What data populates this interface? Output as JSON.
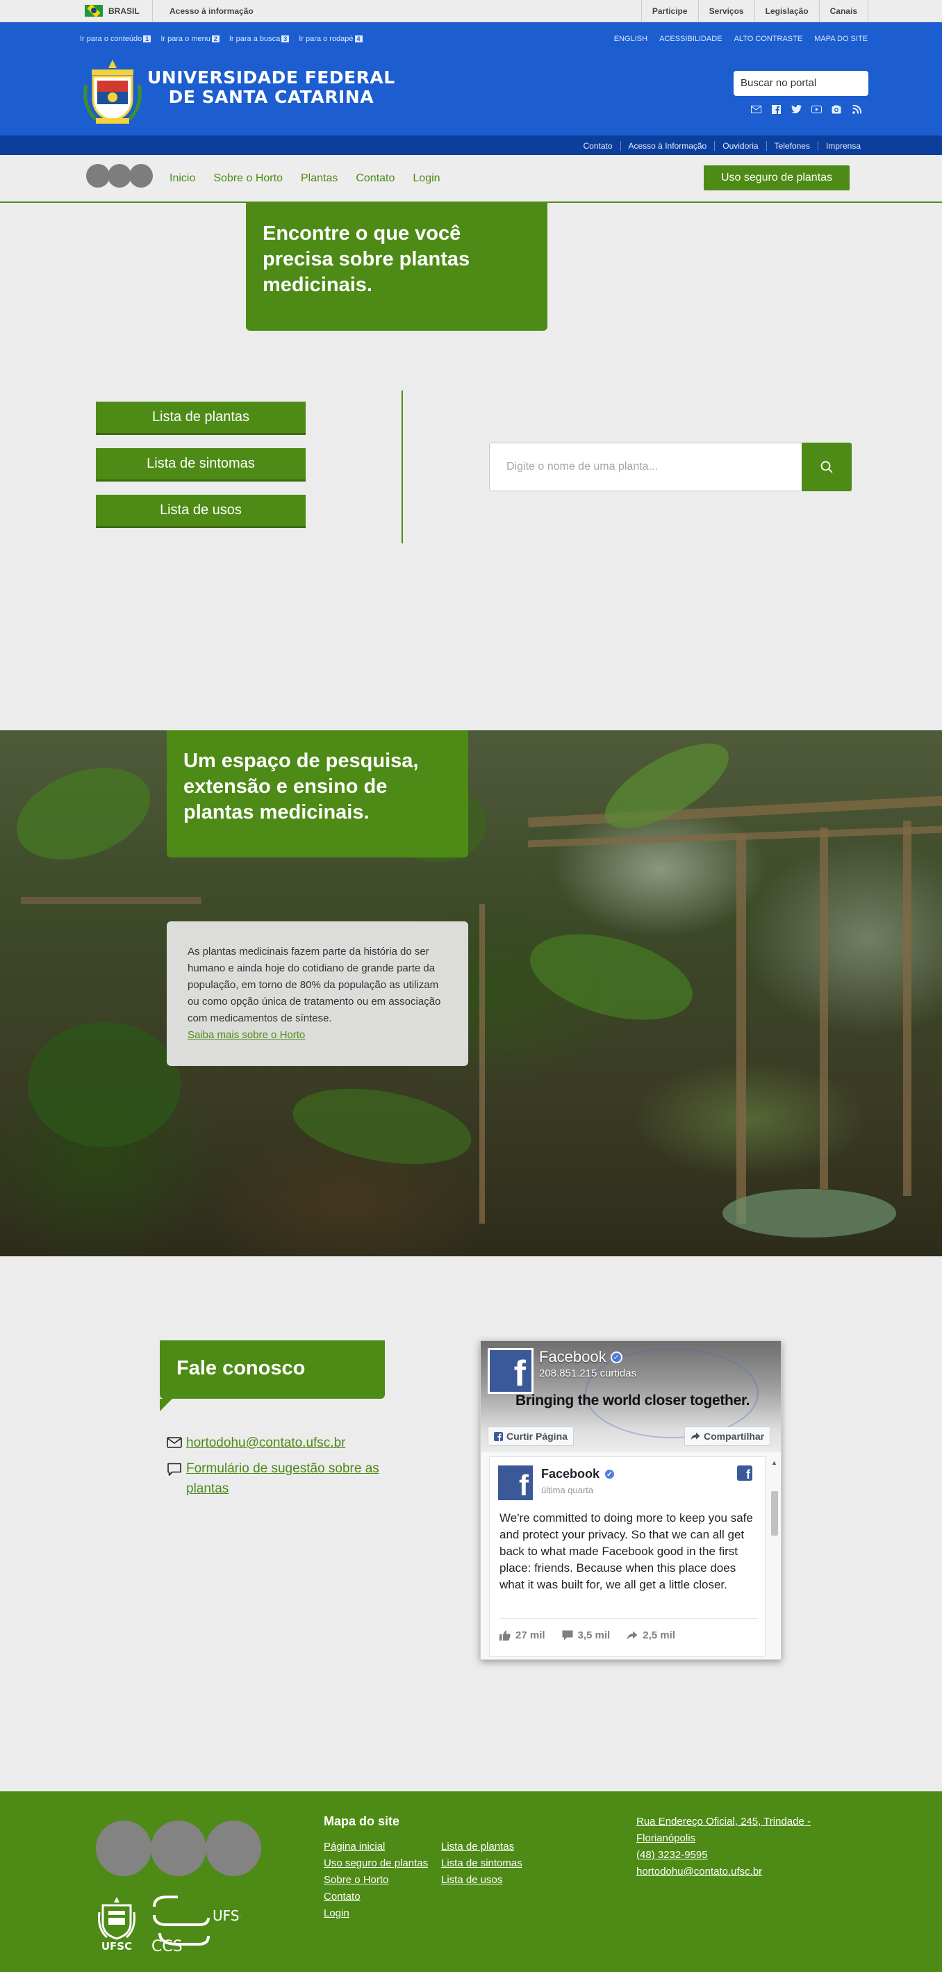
{
  "govbar": {
    "country": "BRASIL",
    "access_info": "Acesso à informação",
    "links": [
      "Participe",
      "Serviços",
      "Legislação",
      "Canais"
    ]
  },
  "header": {
    "skip_links": [
      {
        "label": "Ir para o conteúdo",
        "key": "1"
      },
      {
        "label": "Ir para o menu",
        "key": "2"
      },
      {
        "label": "Ir para a busca",
        "key": "3"
      },
      {
        "label": "Ir para o rodapé",
        "key": "4"
      }
    ],
    "top_links": [
      "ENGLISH",
      "ACESSIBILIDADE",
      "ALTO CONTRASTE",
      "MAPA DO SITE"
    ],
    "university_line1": "UNIVERSIDADE FEDERAL",
    "university_line2": "DE SANTA CATARINA",
    "search_placeholder": "Buscar no portal",
    "social_icons": [
      "email-icon",
      "facebook-icon",
      "twitter-icon",
      "youtube-icon",
      "instagram-icon",
      "rss-icon"
    ],
    "sub_links": [
      "Contato",
      "Acesso à Informação",
      "Ouvidoria",
      "Telefones",
      "Imprensa"
    ]
  },
  "nav": {
    "items": [
      "Inicio",
      "Sobre o Horto",
      "Plantas",
      "Contato",
      "Login"
    ],
    "cta": "Uso seguro de plantas"
  },
  "hero": {
    "title": "Encontre o que você precisa sobre plantas medicinais.",
    "buttons": [
      "Lista de plantas",
      "Lista de sintomas",
      "Lista de usos"
    ],
    "search_placeholder": "Digite o nome de uma planta..."
  },
  "garden": {
    "title": "Um espaço de pesquisa, extensão e ensino de plantas medicinais.",
    "text": "As plantas medicinais fazem parte da história do ser humano e ainda hoje do cotidiano de grande parte da população, em torno de 80% da população as utilizam ou como opção única de tratamento ou em associação com medicamentos de síntese.",
    "link": "Saiba mais sobre o Horto"
  },
  "contact": {
    "title": "Fale conosco",
    "email": "hortodohu@contato.ufsc.br",
    "form": "Formulário de sugestão sobre as plantas"
  },
  "facebook": {
    "page_name": "Facebook",
    "likes": "208.851.215 curtidas",
    "slogan": "Bringing the world closer together.",
    "like_button": "Curtir Página",
    "share_button": "Compartilhar",
    "post_author": "Facebook",
    "post_time": "última quarta",
    "post_body": "We're committed to doing more to keep you safe and protect your privacy. So that we can all get back to what made Facebook good in the first place: friends. Because when this place does what it was built for, we all get a little closer.",
    "reactions": "27 mil",
    "comments": "3,5 mil",
    "shares": "2,5 mil"
  },
  "footer": {
    "sitemap_title": "Mapa do site",
    "col1": [
      "Página inicial",
      "Uso seguro de plantas",
      "Sobre o Horto",
      "Contato",
      "Login"
    ],
    "col2": [
      "Lista de plantas",
      "Lista de sintomas",
      "Lista de usos"
    ],
    "address": "Rua Endereço Oficial, 245, Trindade - Florianópolis",
    "phone": "(48) 3232-9595",
    "email": "hortodohu@contato.ufsc.br",
    "logo_ufsc_text": "UFSC",
    "logo_ccs_text_1": "UFSC",
    "logo_ccs_text_2": "CCS"
  },
  "colors": {
    "green": "#4d8b16",
    "blue": "#1c5ed0",
    "dark_blue": "#0c3e9b",
    "facebook_blue": "#3b5998"
  }
}
